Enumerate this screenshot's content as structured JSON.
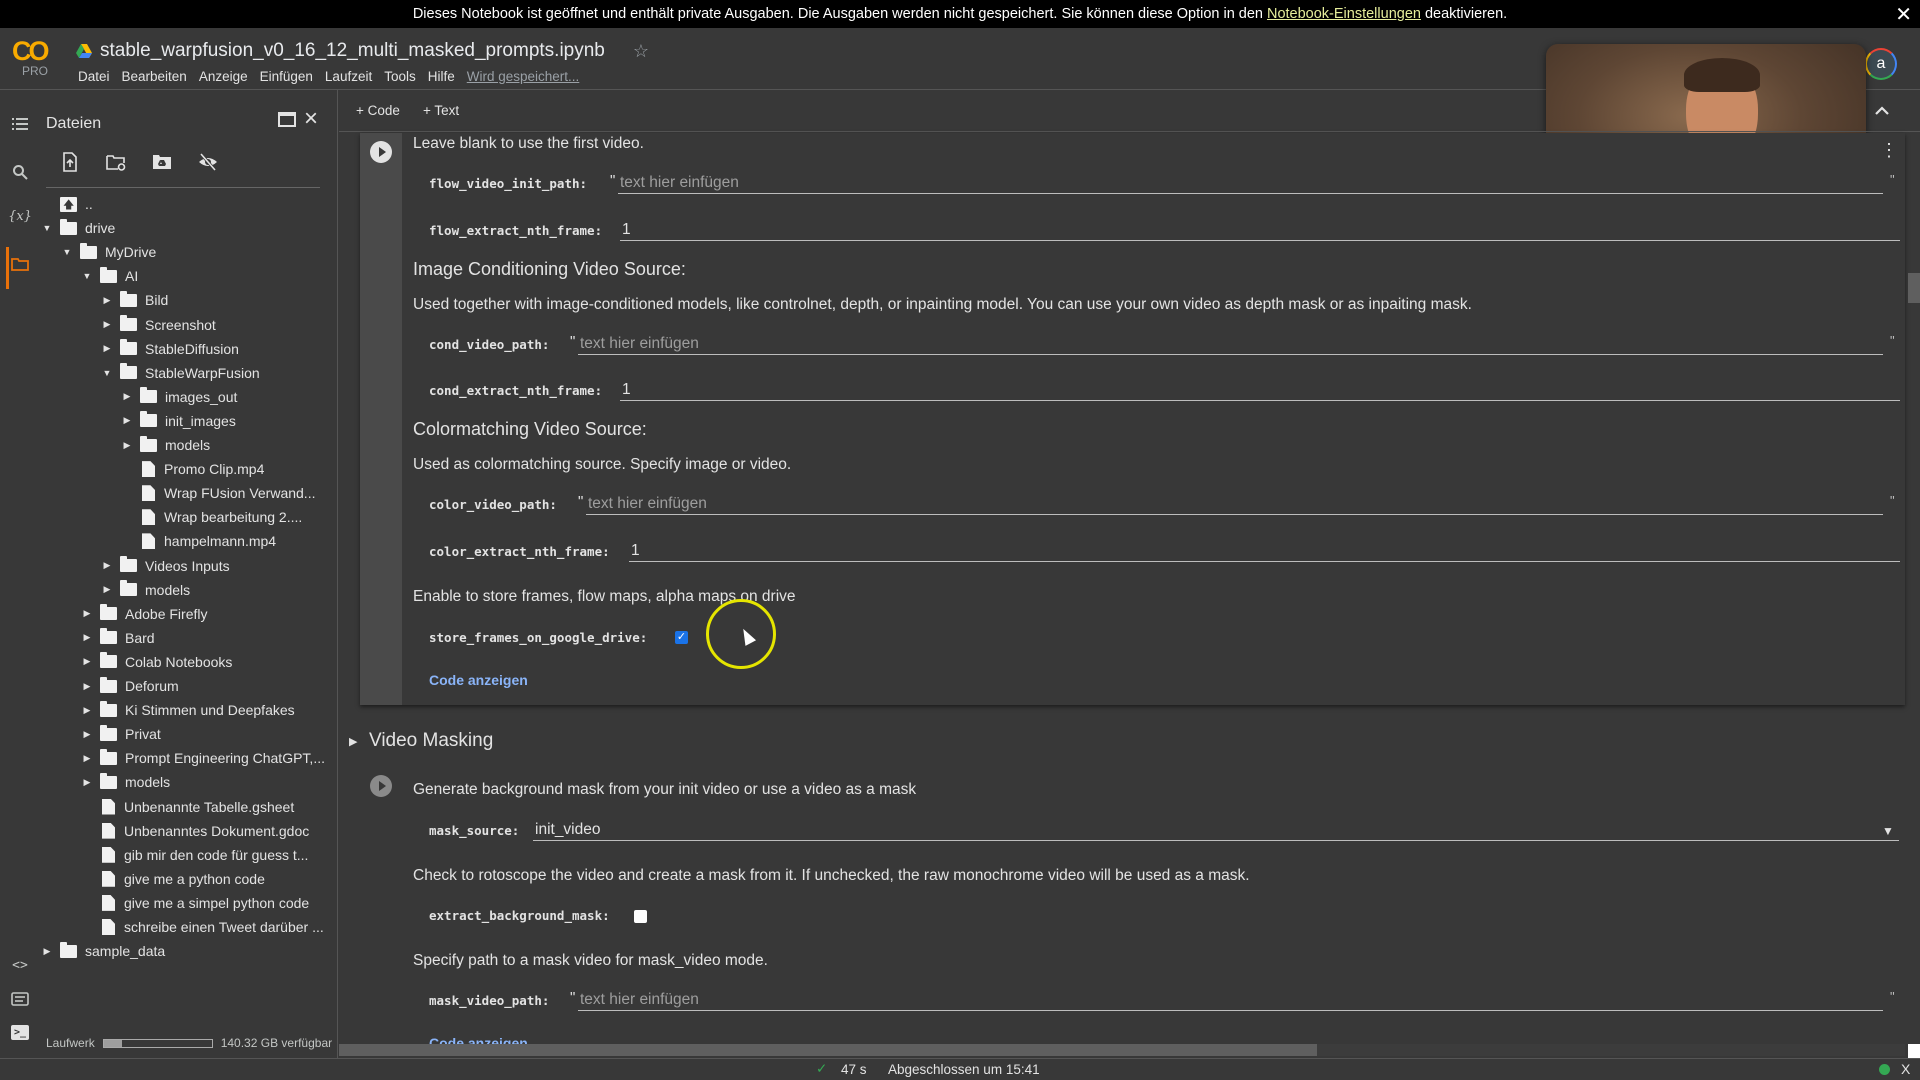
{
  "banner": {
    "text_before": "Dieses Notebook ist geöffnet und enthält private Ausgaben. Die Ausgaben werden nicht gespeichert. Sie können diese Option in den",
    "link": "Notebook-Einstellungen",
    "text_after": "deaktivieren.",
    "close": "✕"
  },
  "header": {
    "logo": "CO",
    "plan": "PRO",
    "notebook_title": "stable_warpfusion_v0_16_12_multi_masked_prompts.ipynb",
    "star": "☆",
    "menu": [
      "Datei",
      "Bearbeiten",
      "Anzeige",
      "Einfügen",
      "Laufzeit",
      "Tools",
      "Hilfe"
    ],
    "save_status": "Wird gespeichert...",
    "avatar_initial": "a"
  },
  "rail": {
    "icons": [
      "toc-icon",
      "search-icon",
      "variables-icon",
      "folder-icon",
      "code-snippets-icon",
      "command-palette-icon",
      "terminal-icon"
    ],
    "variables_glyph": "{x}",
    "code_glyph": "<>",
    "terminal_glyph": ">_"
  },
  "files": {
    "title": "Dateien",
    "tree": [
      {
        "label": "..",
        "type": "up",
        "depth": 0,
        "arrow": ""
      },
      {
        "label": "drive",
        "type": "folder",
        "depth": 0,
        "arrow": "down"
      },
      {
        "label": "MyDrive",
        "type": "folder",
        "depth": 1,
        "arrow": "down"
      },
      {
        "label": "AI",
        "type": "folder",
        "depth": 2,
        "arrow": "down"
      },
      {
        "label": "Bild",
        "type": "folder",
        "depth": 3,
        "arrow": "right"
      },
      {
        "label": "Screenshot",
        "type": "folder",
        "depth": 3,
        "arrow": "right"
      },
      {
        "label": "StableDiffusion",
        "type": "folder",
        "depth": 3,
        "arrow": "right"
      },
      {
        "label": "StableWarpFusion",
        "type": "folder",
        "depth": 3,
        "arrow": "down"
      },
      {
        "label": "images_out",
        "type": "folder",
        "depth": 4,
        "arrow": "right"
      },
      {
        "label": "init_images",
        "type": "folder",
        "depth": 4,
        "arrow": "right"
      },
      {
        "label": "models",
        "type": "folder",
        "depth": 4,
        "arrow": "right"
      },
      {
        "label": "Promo Clip.mp4",
        "type": "file",
        "depth": 4,
        "arrow": ""
      },
      {
        "label": "Wrap FUsion Verwand...",
        "type": "file",
        "depth": 4,
        "arrow": ""
      },
      {
        "label": "Wrap bearbeitung 2....",
        "type": "file",
        "depth": 4,
        "arrow": ""
      },
      {
        "label": "hampelmann.mp4",
        "type": "file",
        "depth": 4,
        "arrow": ""
      },
      {
        "label": "Videos Inputs",
        "type": "folder",
        "depth": 3,
        "arrow": "right"
      },
      {
        "label": "models",
        "type": "folder",
        "depth": 3,
        "arrow": "right"
      },
      {
        "label": "Adobe Firefly",
        "type": "folder",
        "depth": 2,
        "arrow": "right"
      },
      {
        "label": "Bard",
        "type": "folder",
        "depth": 2,
        "arrow": "right"
      },
      {
        "label": "Colab Notebooks",
        "type": "folder",
        "depth": 2,
        "arrow": "right"
      },
      {
        "label": "Deforum",
        "type": "folder",
        "depth": 2,
        "arrow": "right"
      },
      {
        "label": "Ki Stimmen und Deepfakes",
        "type": "folder",
        "depth": 2,
        "arrow": "right"
      },
      {
        "label": "Privat",
        "type": "folder",
        "depth": 2,
        "arrow": "right"
      },
      {
        "label": "Prompt Engineering ChatGPT,...",
        "type": "folder",
        "depth": 2,
        "arrow": "right"
      },
      {
        "label": "models",
        "type": "folder",
        "depth": 2,
        "arrow": "right"
      },
      {
        "label": "Unbenannte Tabelle.gsheet",
        "type": "file",
        "depth": 2,
        "arrow": ""
      },
      {
        "label": "Unbenanntes Dokument.gdoc",
        "type": "file",
        "depth": 2,
        "arrow": ""
      },
      {
        "label": "gib mir den code für guess t...",
        "type": "file",
        "depth": 2,
        "arrow": ""
      },
      {
        "label": "give me a python code",
        "type": "file",
        "depth": 2,
        "arrow": ""
      },
      {
        "label": "give me a simpel python code",
        "type": "file",
        "depth": 2,
        "arrow": ""
      },
      {
        "label": "schreibe einen Tweet darüber ...",
        "type": "file",
        "depth": 2,
        "arrow": ""
      },
      {
        "label": "sample_data",
        "type": "folder",
        "depth": 0,
        "arrow": "right"
      }
    ],
    "storage_label": "Laufwerk",
    "storage_used_fraction": 0.17,
    "storage_free": "140.32 GB verfügbar"
  },
  "toolbar": {
    "add_code": "+ Code",
    "add_text": "+ Text",
    "collapse": "⌃"
  },
  "cell1": {
    "intro": "Leave blank to use the first video.",
    "flow_video_init_path_label": "flow_video_init_path:",
    "flow_video_init_path_placeholder": "text hier einfügen",
    "flow_extract_nth_frame_label": "flow_extract_nth_frame:",
    "flow_extract_nth_frame_value": "1",
    "image_cond_heading": "Image Conditioning Video Source:",
    "image_cond_desc": "Used together with image-conditioned models, like controlnet, depth, or inpainting model. You can use your own video as depth mask or as inpaiting mask.",
    "cond_video_path_label": "cond_video_path:",
    "cond_video_path_placeholder": "text hier einfügen",
    "cond_extract_nth_frame_label": "cond_extract_nth_frame:",
    "cond_extract_nth_frame_value": "1",
    "colormatch_heading": "Colormatching Video Source:",
    "colormatch_desc": "Used as colormatching source. Specify image or video.",
    "color_video_path_label": "color_video_path:",
    "color_video_path_placeholder": "text hier einfügen",
    "color_extract_nth_frame_label": "color_extract_nth_frame:",
    "color_extract_nth_frame_value": "1",
    "store_desc": "Enable to store frames, flow maps, alpha maps on drive",
    "store_frames_label": "store_frames_on_google_drive:",
    "store_frames_checked": true,
    "show_code": "Code anzeigen",
    "quote": "\""
  },
  "section": {
    "title": "Video Masking"
  },
  "cell2": {
    "intro": "Generate background mask from your init video or use a video as a mask",
    "mask_source_label": "mask_source:",
    "mask_source_value": "init_video",
    "roto_desc": "Check to rotoscope the video and create a mask from it. If unchecked, the raw monochrome video will be used as a mask.",
    "extract_bg_label": "extract_background_mask:",
    "extract_bg_checked": false,
    "mask_path_desc": "Specify path to a mask video for mask_video mode.",
    "mask_video_path_label": "mask_video_path:",
    "mask_video_path_placeholder": "text hier einfügen",
    "show_code": "Code anzeigen"
  },
  "status": {
    "check": "✓",
    "duration": "47 s",
    "completed": "Abgeschlossen um 15:41",
    "close": "X"
  },
  "colors": {
    "accent_blue": "#1a73e8",
    "link_blue": "#8ab4f8",
    "status_green": "#34a853",
    "colab_orange": "#f9ab00",
    "banner_link": "#e6ee9c"
  }
}
